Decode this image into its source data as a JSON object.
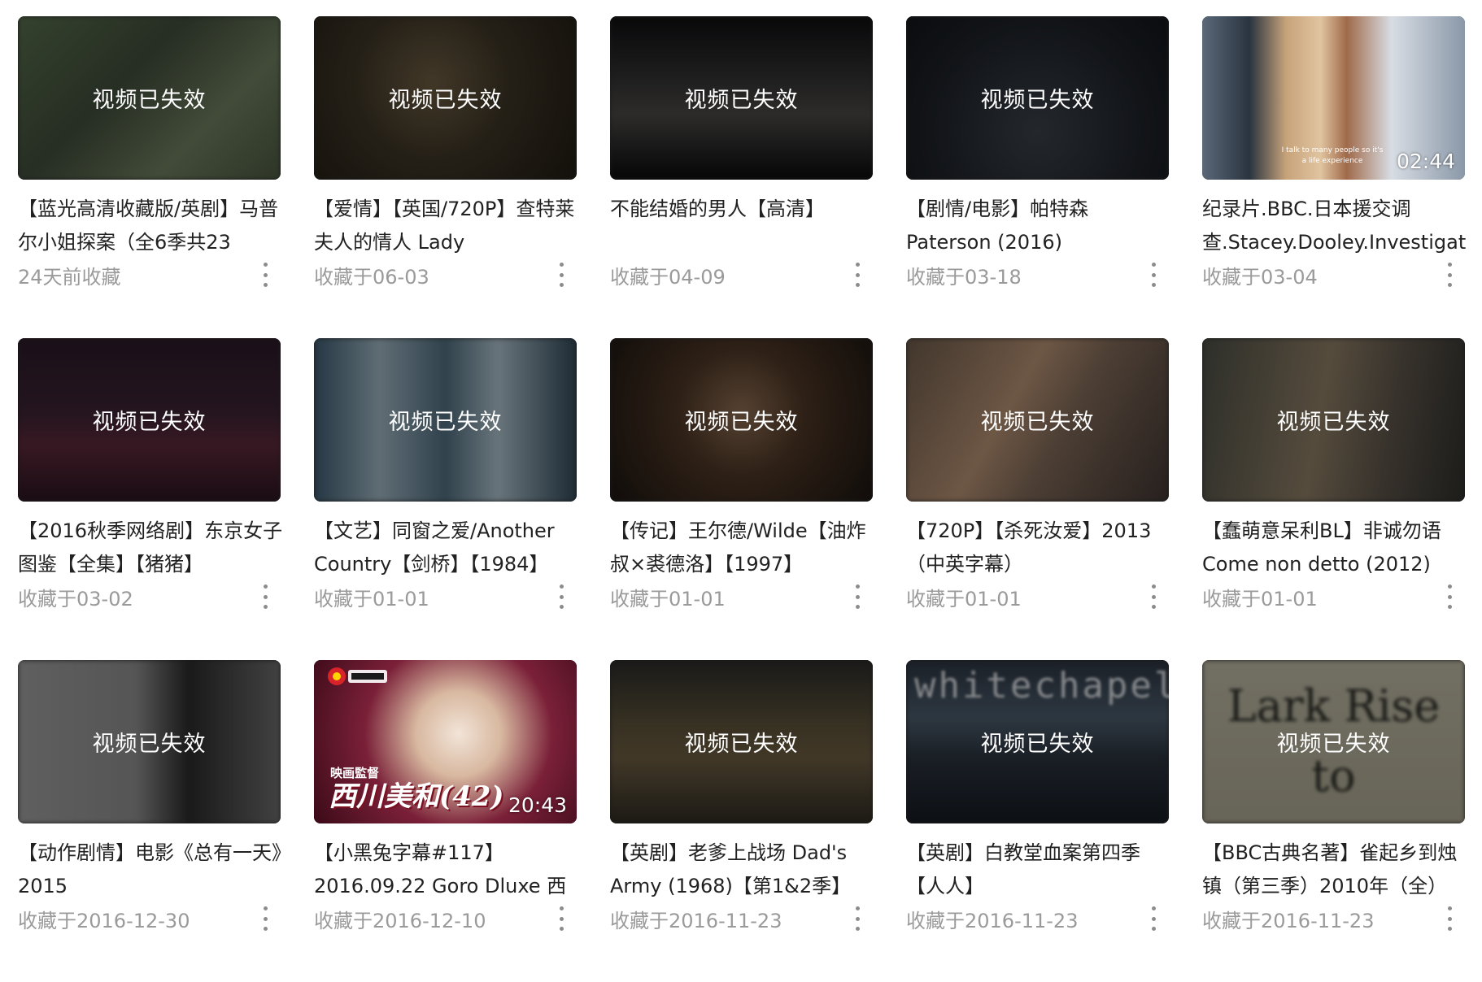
{
  "invalid_label": "视频已失效",
  "cards": [
    {
      "title": "【蓝光高清收藏版/英剧】马普尔小姐探案（全6季共23",
      "date": "24天前收藏",
      "invalid": true,
      "bg": "linear-gradient(135deg,#556b4a 0%,#3f4a3a 40%,#6b7a5c 70%,#4a5640 100%)"
    },
    {
      "title": "【爱情】【英国/720P】查特莱夫人的情人 Lady",
      "date": "收藏于06-03",
      "invalid": true,
      "bg": "radial-gradient(circle at 45% 40%,#6a5a40 0%,#3b3325 45%,#1f1a12 100%)"
    },
    {
      "title": "不能结婚的男人【高清】",
      "date": "收藏于04-09",
      "invalid": true,
      "bg": "linear-gradient(180deg,#0e0e10 0%,#2a2a2c 30%,#4a4744 60%,#202022 85%,#0a0a0a 100%)"
    },
    {
      "title": "【剧情/电影】帕特森 Paterson (2016)",
      "date": "收藏于03-18",
      "invalid": true,
      "bg": "radial-gradient(circle at 50% 70%,#3a4048 0%,#1e2228 60%,#111418 100%)"
    },
    {
      "title": "纪录片.BBC.日本援交调查.Stacey.Dooley.Investigat",
      "date": "收藏于03-04",
      "invalid": false,
      "duration": "02:44",
      "subtitle": "I talk to many people so it's a life experience",
      "bg": "linear-gradient(90deg,#5a6878 0%,#2a3440 18%,#c7a37a 32%,#e0c4a0 45%,#a06a4a 55%,#d8dde4 72%,#8a98a8 100%)"
    },
    {
      "title": "【2016秋季网络剧】东京女子图鉴【全集】【猪猪】",
      "date": "收藏于03-02",
      "invalid": true,
      "bg": "linear-gradient(180deg,#2a1a28 0%,#3a2232 45%,#5a2838 65%,#2a1420 100%)"
    },
    {
      "title": "【文艺】同窗之爱/Another Country【剑桥】【1984】",
      "date": "收藏于01-01",
      "invalid": true,
      "bg": "linear-gradient(90deg,#3c5a6e 0%,#9ab0bc 25%,#4f6b7c 50%,#a8bcc6 70%,#2f4656 100%)"
    },
    {
      "title": "【传记】王尔德/Wilde【油炸叔×裘德洛】【1997】",
      "date": "收藏于01-01",
      "invalid": true,
      "bg": "radial-gradient(circle at 50% 45%,#8a6a50 0%,#4a3424 40%,#1a1410 100%)"
    },
    {
      "title": "【720P】【杀死汝爱】2013（中英字幕）",
      "date": "收藏于01-01",
      "invalid": true,
      "bg": "linear-gradient(120deg,#6a5848 0%,#b08c70 40%,#7a6454 60%,#3e3430 100%)"
    },
    {
      "title": "【蠢萌意呆利BL】非诚勿语 Come non detto (2012)",
      "date": "收藏于01-01",
      "invalid": true,
      "bg": "linear-gradient(100deg,#4a4c44 0%,#8a7a62 45%,#5a5248 70%,#2e2e2a 100%)"
    },
    {
      "title": "【动作剧情】电影《总有一天》2015",
      "date": "收藏于2016-12-30",
      "invalid": true,
      "bg": "linear-gradient(90deg,#9a9a9a 0%,#8a8a8a 45%,#2a2a2a 65%,#6a6a6a 100%)"
    },
    {
      "title": "【小黑兔字幕#117】2016.09.22 Goro Dluxe 西",
      "date": "收藏于2016-12-10",
      "invalid": false,
      "duration": "20:43",
      "jp_small": "映画監督",
      "jp_name": "西川美和(42)",
      "bg": "radial-gradient(circle at 55% 45%,#f2e4d8 0%,#d8b8a0 25%,#7a2038 55%,#3a0a18 100%)"
    },
    {
      "title": "【英剧】老爹上战场 Dad's Army (1968)【第1&2季】",
      "date": "收藏于2016-11-23",
      "invalid": true,
      "bg": "linear-gradient(180deg,#2a2a28 0%,#5a5038 40%,#6a5a40 60%,#2e2a22 100%)"
    },
    {
      "title": "【英剧】白教堂血案第四季【人人】",
      "date": "收藏于2016-11-23",
      "invalid": true,
      "bg": "linear-gradient(180deg,#2c3440 0%,#4a5a6a 35%,#2a323c 60%,#141a22 100%)",
      "overlay_text": "whitechapel"
    },
    {
      "title": "【BBC古典名著】雀起乡到烛镇（第三季）2010年（全）",
      "date": "收藏于2016-11-23",
      "invalid": true,
      "bg": "linear-gradient(180deg,#b8b4a0 0%,#a8a48e 100%)",
      "overlay_text": "Lark Rise to Candleford"
    }
  ]
}
